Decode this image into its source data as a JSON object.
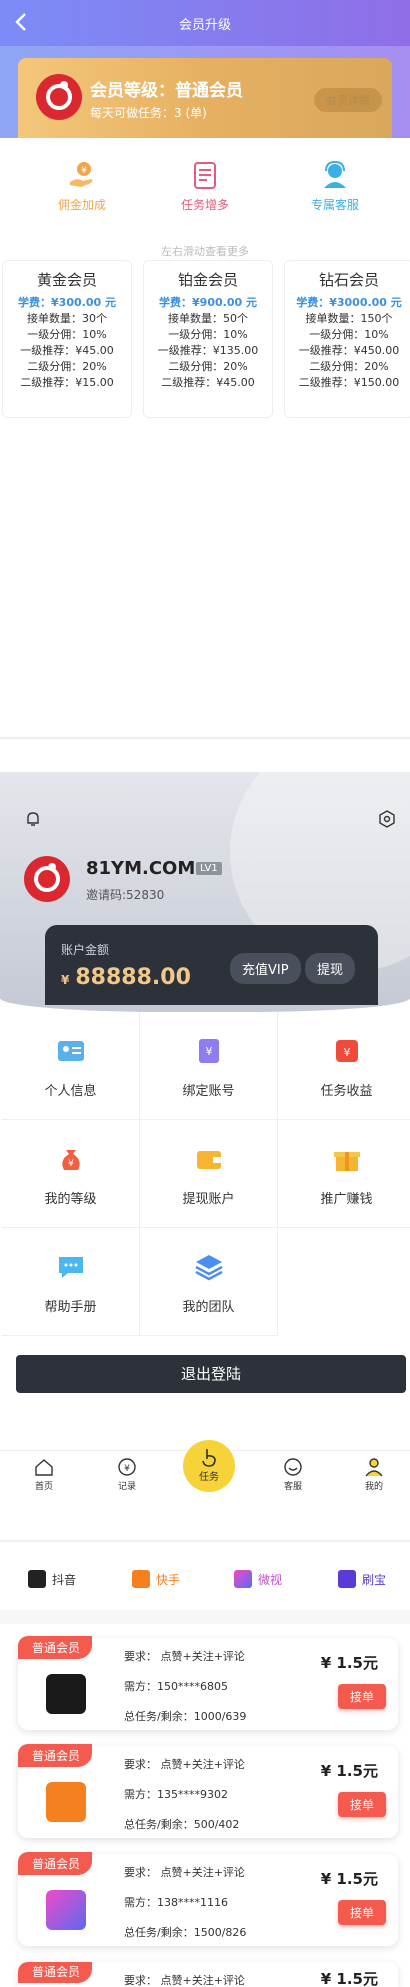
{
  "header": {
    "title": "会员升级",
    "back_icon": "chevron-left-icon"
  },
  "member_card": {
    "level_text": "会员等级：普通会员",
    "daily_tasks": "每天可做任务：3 (单)",
    "detail_button": "会员详情"
  },
  "features": [
    {
      "label": "佣金加成",
      "icon": "hand-coin-icon",
      "color": "#f2a64c"
    },
    {
      "label": "任务增多",
      "icon": "document-icon",
      "color": "#e85a7a"
    },
    {
      "label": "专属客服",
      "icon": "support-agent-icon",
      "color": "#3bb0e6"
    }
  ],
  "scroll_hint": "左右滑动查看更多",
  "plans": [
    {
      "name": "黄金会员",
      "fee": "学费：¥300.00 元",
      "count": "接单数量：30个",
      "l1_share": "一级分佣：10%",
      "l1_ref": "一级推荐：¥45.00",
      "l2_share": "二级分佣：20%",
      "l2_ref": "二级推荐：¥15.00"
    },
    {
      "name": "铂金会员",
      "fee": "学费：¥900.00 元",
      "count": "接单数量：50个",
      "l1_share": "一级分佣：10%",
      "l1_ref": "一级推荐：¥135.00",
      "l2_share": "二级分佣：20%",
      "l2_ref": "二级推荐：¥45.00"
    },
    {
      "name": "钻石会员",
      "fee": "学费：¥3000.00 元",
      "count": "接单数量：150个",
      "l1_share": "一级分佣：10%",
      "l1_ref": "一级推荐：¥450.00",
      "l2_share": "二级分佣：20%",
      "l2_ref": "二级推荐：¥150.00"
    }
  ],
  "profile": {
    "name": "81YM.COM",
    "level": "LV1",
    "invite": "邀请码:52830",
    "balance_label": "账户金额",
    "currency": "¥",
    "balance": "88888.00",
    "recharge": "充值VIP",
    "withdraw": "提现"
  },
  "menu": [
    {
      "label": "个人信息",
      "icon": "id-card-icon",
      "color": "#5ab0e8"
    },
    {
      "label": "绑定账号",
      "icon": "account-bind-icon",
      "color": "#8f7cf0"
    },
    {
      "label": "任务收益",
      "icon": "wallet-income-icon",
      "color": "#f04a3a"
    },
    {
      "label": "我的等级",
      "icon": "money-bag-icon",
      "color": "#f06040"
    },
    {
      "label": "提现账户",
      "icon": "wallet-icon",
      "color": "#f5b530"
    },
    {
      "label": "推广赚钱",
      "icon": "gift-icon",
      "color": "#f5b530"
    },
    {
      "label": "帮助手册",
      "icon": "chat-bubble-icon",
      "color": "#4ab8ee"
    },
    {
      "label": "我的团队",
      "icon": "layers-icon",
      "color": "#4a8ef0"
    }
  ],
  "logout": "退出登陆",
  "tabbar": [
    {
      "label": "首页",
      "icon": "home-icon"
    },
    {
      "label": "记录",
      "icon": "record-icon"
    },
    {
      "label": "任务",
      "icon": "hand-tap-icon"
    },
    {
      "label": "客服",
      "icon": "smile-icon"
    },
    {
      "label": "我的",
      "icon": "user-icon"
    }
  ],
  "platforms": [
    {
      "label": "抖音",
      "icon": "tiktok-icon",
      "color": "#222222"
    },
    {
      "label": "快手",
      "icon": "kuaishou-icon",
      "color": "#f5801f"
    },
    {
      "label": "微视",
      "icon": "weishi-icon",
      "color": "#c050c8"
    },
    {
      "label": "刷宝",
      "icon": "shuabao-icon",
      "color": "#5a3ad8"
    }
  ],
  "tasks": [
    {
      "badge": "普通会员",
      "req": "要求：  点赞+关注+评论",
      "who": "需方：150****6805",
      "total": "总任务/剩余：1000/639",
      "price": "¥ 1.5元",
      "button": "接单",
      "app": "tiktok-icon",
      "app_color": "#1a1a1a"
    },
    {
      "badge": "普通会员",
      "req": "要求：  点赞+关注+评论",
      "who": "需方：135****9302",
      "total": "总任务/剩余：500/402",
      "price": "¥ 1.5元",
      "button": "接单",
      "app": "kuaishou-icon",
      "app_color": "#f5801f"
    },
    {
      "badge": "普通会员",
      "req": "要求：  点赞+关注+评论",
      "who": "需方：138****1116",
      "total": "总任务/剩余：1500/826",
      "price": "¥ 1.5元",
      "button": "接单",
      "app": "weishi-icon",
      "app_color": "#7a5af0"
    },
    {
      "badge": "普通会员",
      "req": "要求：  点赞+关注+评论",
      "price": "¥ 1.5元"
    }
  ]
}
